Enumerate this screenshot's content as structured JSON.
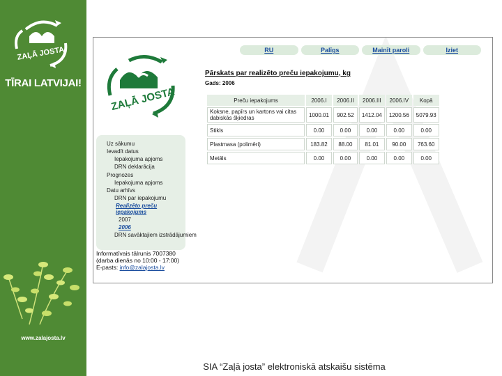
{
  "sidebar": {
    "logo_text": "ZAĻĀ JOSTA",
    "slogan": "TĪRAI LATVIJAI!",
    "site_url": "www.zalajosta.lv"
  },
  "nav": {
    "items": [
      "RU",
      "Palīgs",
      "Mainīt paroli",
      "Iziet"
    ]
  },
  "logo": {
    "text": "ZAĻĀ JOSTA"
  },
  "menu": {
    "items": [
      {
        "label": "Uz sākumu",
        "level": 0
      },
      {
        "label": "Ievadīt datus",
        "level": 0
      },
      {
        "label": "Iepakojuma apjoms",
        "level": 1
      },
      {
        "label": "DRN deklarācija",
        "level": 1
      },
      {
        "label": "Prognozes",
        "level": 0
      },
      {
        "label": "Iepakojuma apjoms",
        "level": 1
      },
      {
        "label": "Datu arhīvs",
        "level": 0
      },
      {
        "label": "DRN par iepakojumu",
        "level": 1
      },
      {
        "label": "Realizēto preču iepakojums",
        "level": 2
      },
      {
        "label": "2007",
        "level": 3
      },
      {
        "label": "2006",
        "level": 3
      },
      {
        "label": "DRN savāktajiem izstrādājumiem",
        "level": 1
      }
    ]
  },
  "contact": {
    "line1": "Informatīvais tālrunis 7007380",
    "line2": "(darba dienās no 10:00 - 17:00)",
    "email_label": "E-pasts:",
    "email": "info@zalajosta.lv"
  },
  "report": {
    "title": "Pārskats par realizēto preču iepakojumu, kg",
    "year_label": "Gads: 2006"
  },
  "table": {
    "headers": [
      "Preču iepakojums",
      "2006.I",
      "2006.II",
      "2006.III",
      "2006.IV",
      "Kopā"
    ],
    "rows": [
      [
        "Koksne, papīrs un kartons vai citas dabiskās šķiedras",
        "1000.01",
        "902.52",
        "1412.04",
        "1200.56",
        "5079.93"
      ],
      [
        "Stikls",
        "0.00",
        "0.00",
        "0.00",
        "0.00",
        "0.00"
      ],
      [
        "Plastmasa (polimēri)",
        "183.82",
        "88.00",
        "81.01",
        "90.00",
        "763.60"
      ],
      [
        "Metāls",
        "0.00",
        "0.00",
        "0.00",
        "0.00",
        "0.00"
      ]
    ]
  },
  "footer": {
    "text": "SIA “Zaļā josta” elektroniskā atskaišu sistēma"
  },
  "colors": {
    "sidebar_green": "#4f8a34",
    "logo_green": "#1e7a3a",
    "panel": "#e6efe6",
    "link": "#1a4d9e"
  }
}
